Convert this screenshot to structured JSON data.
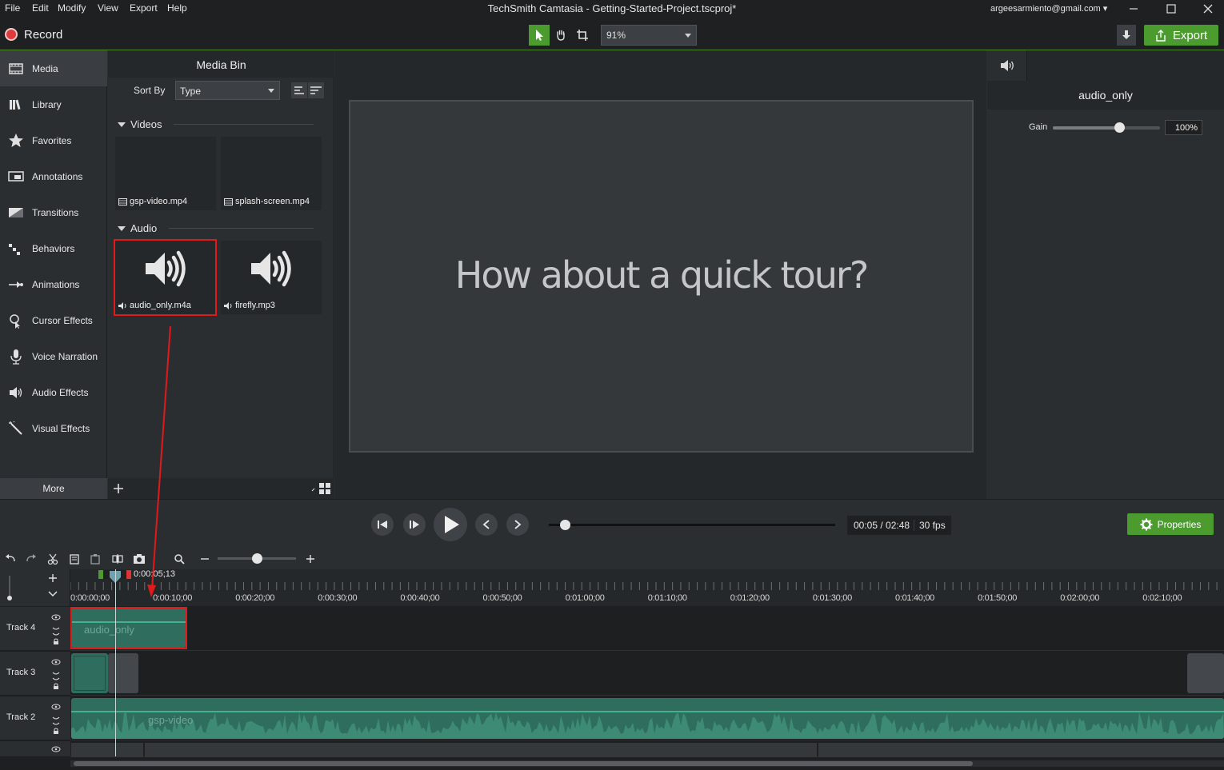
{
  "titlebar": {
    "menus": [
      "File",
      "Edit",
      "Modify",
      "View",
      "Export",
      "Help"
    ],
    "title": "TechSmith Camtasia - Getting-Started-Project.tscproj*",
    "account": "argeesarmiento@gmail.com"
  },
  "toolbar": {
    "record_label": "Record",
    "zoom": "91%",
    "export_label": "Export"
  },
  "leftnav": {
    "items": [
      {
        "label": "Media",
        "icon": "media-icon"
      },
      {
        "label": "Library",
        "icon": "library-icon"
      },
      {
        "label": "Favorites",
        "icon": "star-icon"
      },
      {
        "label": "Annotations",
        "icon": "annotation-icon"
      },
      {
        "label": "Transitions",
        "icon": "transition-icon"
      },
      {
        "label": "Behaviors",
        "icon": "behavior-icon"
      },
      {
        "label": "Animations",
        "icon": "animation-icon"
      },
      {
        "label": "Cursor Effects",
        "icon": "cursor-icon"
      },
      {
        "label": "Voice Narration",
        "icon": "microphone-icon"
      },
      {
        "label": "Audio Effects",
        "icon": "speaker-icon"
      },
      {
        "label": "Visual Effects",
        "icon": "wand-icon"
      }
    ],
    "more_label": "More"
  },
  "mediabin": {
    "title": "Media Bin",
    "sort_label": "Sort By",
    "sort_value": "Type",
    "videos_label": "Videos",
    "audio_label": "Audio",
    "videos": [
      "gsp-video.mp4",
      "splash-screen.mp4"
    ],
    "audio": [
      "audio_only.m4a",
      "firefly.mp3"
    ]
  },
  "canvas": {
    "text": "How about a quick tour?"
  },
  "properties": {
    "title": "audio_only",
    "gain_label": "Gain",
    "gain_value": "100%",
    "gain_fraction": 0.62
  },
  "playback": {
    "time": "00:05 / 02:48",
    "fps": "30 fps",
    "properties_label": "Properties",
    "progress_fraction": 0.03
  },
  "timeline": {
    "playhead_time": "0:00:05;13",
    "ruler_labels": [
      "0:00:00;00",
      "0:00:10;00",
      "0:00:20;00",
      "0:00:30;00",
      "0:00:40;00",
      "0:00:50;00",
      "0:01:00;00",
      "0:01:10;00",
      "0:01:20;00",
      "0:01:30;00",
      "0:01:40;00",
      "0:01:50;00",
      "0:02:00;00",
      "0:02:10;00"
    ],
    "tracks": [
      {
        "name": "Track 4",
        "clip_label": "audio_only"
      },
      {
        "name": "Track 3",
        "clip_label": ""
      },
      {
        "name": "Track 2",
        "clip_label": "gsp-video"
      }
    ],
    "zoom_fraction": 0.5
  }
}
